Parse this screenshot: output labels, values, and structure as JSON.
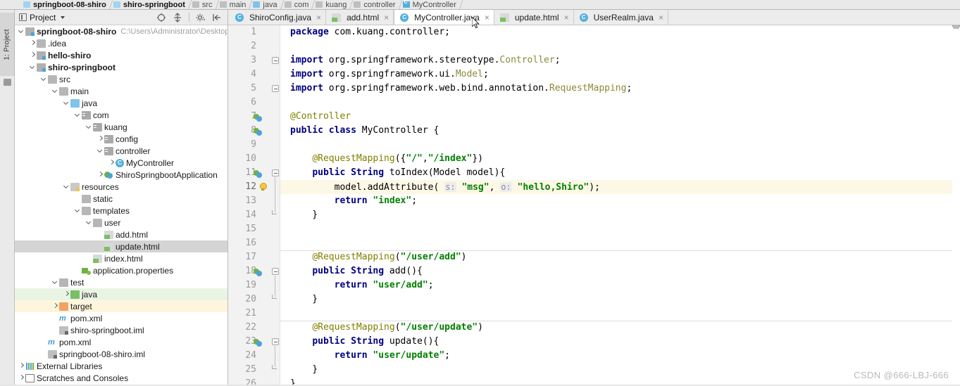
{
  "breadcrumb": {
    "items": [
      {
        "label": "springboot-08-shiro",
        "icon": "module-icon",
        "bold": true
      },
      {
        "label": "shiro-springboot",
        "icon": "module-icon",
        "bold": true
      },
      {
        "label": "src",
        "icon": "folder-icon",
        "bold": false
      },
      {
        "label": "main",
        "icon": "folder-icon",
        "bold": false
      },
      {
        "label": "java",
        "icon": "source-folder-icon",
        "bold": false
      },
      {
        "label": "com",
        "icon": "folder-icon",
        "bold": false
      },
      {
        "label": "kuang",
        "icon": "folder-icon",
        "bold": false
      },
      {
        "label": "controller",
        "icon": "folder-icon",
        "bold": false
      },
      {
        "label": "MyController",
        "icon": "java-class-icon",
        "bold": false
      }
    ]
  },
  "left_rail": {
    "tab_label": "1: Project"
  },
  "project_panel": {
    "title": "Project",
    "toolbar": [
      {
        "name": "collapse-all-icon",
        "tooltip": "Collapse All"
      },
      {
        "name": "expand-all-icon",
        "tooltip": "Expand All"
      },
      {
        "name": "gear-icon",
        "tooltip": "Settings"
      },
      {
        "name": "hide-panel-icon",
        "tooltip": "Hide"
      }
    ],
    "tree": [
      {
        "indent": 0,
        "arrow": "down",
        "icon": "module-icon",
        "label": "springboot-08-shiro",
        "bold": true,
        "note": "C:\\Users\\Administrator\\Desktop\\S",
        "state": ""
      },
      {
        "indent": 1,
        "arrow": "right",
        "icon": "folder-icon",
        "label": ".idea",
        "bold": false,
        "note": "",
        "state": ""
      },
      {
        "indent": 1,
        "arrow": "right",
        "icon": "module-icon",
        "label": "hello-shiro",
        "bold": true,
        "note": "",
        "state": ""
      },
      {
        "indent": 1,
        "arrow": "down",
        "icon": "module-icon",
        "label": "shiro-springboot",
        "bold": true,
        "note": "",
        "state": ""
      },
      {
        "indent": 2,
        "arrow": "down",
        "icon": "folder-icon",
        "label": "src",
        "bold": false,
        "note": "",
        "state": ""
      },
      {
        "indent": 3,
        "arrow": "down",
        "icon": "folder-icon",
        "label": "main",
        "bold": false,
        "note": "",
        "state": ""
      },
      {
        "indent": 4,
        "arrow": "down",
        "icon": "source-folder-icon",
        "label": "java",
        "bold": false,
        "note": "",
        "state": ""
      },
      {
        "indent": 5,
        "arrow": "down",
        "icon": "package-icon",
        "label": "com",
        "bold": false,
        "note": "",
        "state": ""
      },
      {
        "indent": 6,
        "arrow": "down",
        "icon": "package-icon",
        "label": "kuang",
        "bold": false,
        "note": "",
        "state": ""
      },
      {
        "indent": 7,
        "arrow": "right",
        "icon": "package-icon",
        "label": "config",
        "bold": false,
        "note": "",
        "state": ""
      },
      {
        "indent": 7,
        "arrow": "down",
        "icon": "package-icon",
        "label": "controller",
        "bold": false,
        "note": "",
        "state": ""
      },
      {
        "indent": 8,
        "arrow": "right",
        "icon": "java-class-icon",
        "label": "MyController",
        "bold": false,
        "note": "",
        "state": ""
      },
      {
        "indent": 7,
        "arrow": "right",
        "icon": "spring-boot-icon",
        "label": "ShiroSpringbootApplication",
        "bold": false,
        "note": "",
        "state": ""
      },
      {
        "indent": 4,
        "arrow": "down",
        "icon": "resources-icon",
        "label": "resources",
        "bold": false,
        "note": "",
        "state": ""
      },
      {
        "indent": 5,
        "arrow": "none",
        "icon": "folder-icon",
        "label": "static",
        "bold": false,
        "note": "",
        "state": ""
      },
      {
        "indent": 5,
        "arrow": "down",
        "icon": "folder-icon",
        "label": "templates",
        "bold": false,
        "note": "",
        "state": ""
      },
      {
        "indent": 6,
        "arrow": "down",
        "icon": "folder-icon",
        "label": "user",
        "bold": false,
        "note": "",
        "state": ""
      },
      {
        "indent": 7,
        "arrow": "none",
        "icon": "html-file-icon",
        "label": "add.html",
        "bold": false,
        "note": "",
        "state": ""
      },
      {
        "indent": 7,
        "arrow": "none",
        "icon": "html-file-icon",
        "label": "update.html",
        "bold": false,
        "note": "",
        "state": "selected"
      },
      {
        "indent": 6,
        "arrow": "none",
        "icon": "html-file-icon",
        "label": "index.html",
        "bold": false,
        "note": "",
        "state": ""
      },
      {
        "indent": 5,
        "arrow": "none",
        "icon": "properties-file-icon",
        "label": "application.properties",
        "bold": false,
        "note": "",
        "state": ""
      },
      {
        "indent": 3,
        "arrow": "down",
        "icon": "folder-icon",
        "label": "test",
        "bold": false,
        "note": "",
        "state": ""
      },
      {
        "indent": 4,
        "arrow": "right",
        "icon": "test-source-icon",
        "label": "java",
        "bold": false,
        "note": "",
        "state": "green"
      },
      {
        "indent": 3,
        "arrow": "right",
        "icon": "target-folder-icon",
        "label": "target",
        "bold": false,
        "note": "",
        "state": "yellow"
      },
      {
        "indent": 3,
        "arrow": "none",
        "icon": "maven-xml-icon",
        "label": "pom.xml",
        "bold": false,
        "note": "",
        "state": ""
      },
      {
        "indent": 3,
        "arrow": "none",
        "icon": "iml-file-icon",
        "label": "shiro-springboot.iml",
        "bold": false,
        "note": "",
        "state": ""
      },
      {
        "indent": 2,
        "arrow": "none",
        "icon": "maven-xml-icon",
        "label": "pom.xml",
        "bold": false,
        "note": "",
        "state": ""
      },
      {
        "indent": 2,
        "arrow": "none",
        "icon": "iml-file-icon",
        "label": "springboot-08-shiro.iml",
        "bold": false,
        "note": "",
        "state": ""
      },
      {
        "indent": 0,
        "arrow": "right",
        "icon": "external-libraries-icon",
        "label": "External Libraries",
        "bold": false,
        "note": "",
        "state": ""
      },
      {
        "indent": 0,
        "arrow": "right",
        "icon": "scratches-icon",
        "label": "Scratches and Consoles",
        "bold": false,
        "note": "",
        "state": ""
      }
    ]
  },
  "editor": {
    "tabs": [
      {
        "label": "ShiroConfig.java",
        "icon": "java-class-icon",
        "active": false
      },
      {
        "label": "add.html",
        "icon": "html-file-icon",
        "active": false
      },
      {
        "label": "MyController.java",
        "icon": "java-class-icon",
        "active": true
      },
      {
        "label": "update.html",
        "icon": "html-file-icon",
        "active": false
      },
      {
        "label": "UserRealm.java",
        "icon": "java-class-icon",
        "active": false
      }
    ],
    "current_line": 12,
    "lines": [
      {
        "n": 1,
        "text": "package com.kuang.controller;"
      },
      {
        "n": 2,
        "text": ""
      },
      {
        "n": 3,
        "text": "import org.springframework.stereotype.Controller;"
      },
      {
        "n": 4,
        "text": "import org.springframework.ui.Model;"
      },
      {
        "n": 5,
        "text": "import org.springframework.web.bind.annotation.RequestMapping;"
      },
      {
        "n": 6,
        "text": ""
      },
      {
        "n": 7,
        "text": "@Controller"
      },
      {
        "n": 8,
        "text": "public class MyController {"
      },
      {
        "n": 9,
        "text": ""
      },
      {
        "n": 10,
        "text": "    @RequestMapping({\"/\",\"/index\"})"
      },
      {
        "n": 11,
        "text": "    public String toIndex(Model model){"
      },
      {
        "n": 12,
        "text": "        model.addAttribute( s: \"msg\", o: \"hello,Shiro\");"
      },
      {
        "n": 13,
        "text": "        return \"index\";"
      },
      {
        "n": 14,
        "text": "    }"
      },
      {
        "n": 15,
        "text": ""
      },
      {
        "n": 16,
        "text": ""
      },
      {
        "n": 17,
        "text": "    @RequestMapping(\"/user/add\")"
      },
      {
        "n": 18,
        "text": "    public String add(){"
      },
      {
        "n": 19,
        "text": "        return \"user/add\";"
      },
      {
        "n": 20,
        "text": "    }"
      },
      {
        "n": 21,
        "text": ""
      },
      {
        "n": 22,
        "text": "    @RequestMapping(\"/user/update\")"
      },
      {
        "n": 23,
        "text": "    public String update(){"
      },
      {
        "n": 24,
        "text": "        return \"user/update\";"
      },
      {
        "n": 25,
        "text": "    }"
      },
      {
        "n": 26,
        "text": "}"
      }
    ],
    "gutter_marks": [
      {
        "line": 7,
        "mark": "spring-bean-icon"
      },
      {
        "line": 8,
        "mark": "spring-bean-icon"
      },
      {
        "line": 11,
        "mark": "spring-bean-icon"
      },
      {
        "line": 12,
        "mark": "intention-bulb-icon"
      },
      {
        "line": 18,
        "mark": "spring-bean-icon"
      },
      {
        "line": 23,
        "mark": "spring-bean-icon"
      }
    ]
  },
  "watermark": {
    "text": "CSDN @666-LBJ-666"
  },
  "colors": {
    "keyword": "#000080",
    "string": "#008000",
    "annotation": "#808000",
    "class_ref": "#8a8a3a",
    "current_line_bg": "#fdf8e6",
    "selection_bg": "#d4d4d4",
    "panel_bg": "#ececec"
  }
}
